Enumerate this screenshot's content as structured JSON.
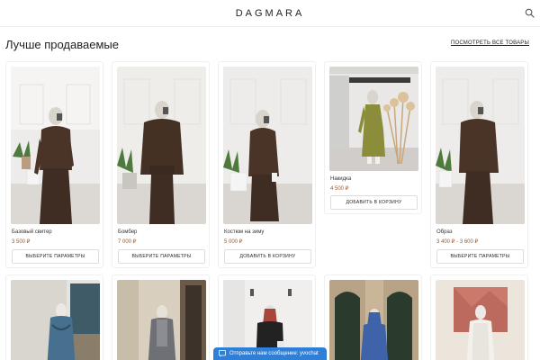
{
  "header": {
    "logo": "DAGMARA",
    "search_icon": "search-icon"
  },
  "section": {
    "title": "Лучше продаваемые",
    "view_all": "ПОСМОТРЕТЬ ВСЕ ТОВАРЫ"
  },
  "products": [
    {
      "name": "Базовый свитер",
      "price": "3 500 ₽",
      "button": "ВЫБЕРИТЕ ПАРАМЕТРЫ"
    },
    {
      "name": "Бомбер",
      "price": "7 000 ₽",
      "button": "ВЫБЕРИТЕ ПАРАМЕТРЫ"
    },
    {
      "name": "Костюм на зиму",
      "price": "5 000 ₽",
      "button": "ДОБАВИТЬ В КОРЗИНУ"
    },
    {
      "name": "Накидка",
      "price": "4 500 ₽",
      "button": "ДОБАВИТЬ В КОРЗИНУ"
    },
    {
      "name": "Образ",
      "price": "3 400 ₽ - 3 600 ₽",
      "button": "ВЫБЕРИТЕ ПАРАМЕТРЫ"
    }
  ],
  "chat": {
    "label": "Отправьте нам сообщение: yvochat",
    "icon": "chat-icon"
  },
  "colors": {
    "price": "#9a5a2e",
    "chat": "#2f7fd6",
    "border": "#f0f0f0"
  }
}
